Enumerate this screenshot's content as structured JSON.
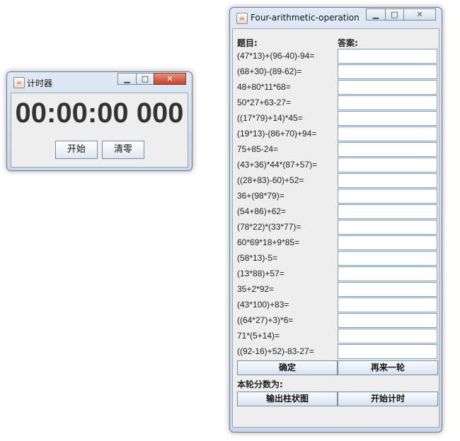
{
  "stopwatch": {
    "title": "计时器",
    "display": "00:00:00 000",
    "start_label": "开始",
    "clear_label": "清零",
    "minimize_glyph": "▁",
    "maximize_glyph": "□",
    "close_glyph": "✕"
  },
  "quiz": {
    "title": "Four-arithmetic-operation",
    "minimize_glyph": "▁",
    "maximize_glyph": "□",
    "close_glyph": "✕",
    "question_header": "题目:",
    "answer_header": "答案:",
    "questions": [
      "(47*13)+(96-40)-94=",
      "(68+30)-(89-62)=",
      "48+80*11*68=",
      "50*27+63-27=",
      "((17*79)+14)*45=",
      "(19*13)-(86+70)+94=",
      "75+85-24=",
      "(43+36)*44*(87+57)=",
      "((28+83)-60)+52=",
      "36+(98*79)=",
      "(54+86)+62=",
      "(78*22)*(33*77)=",
      "60*69*18+9*85=",
      "(58*13)-5=",
      "(13*88)+57=",
      "35+2*92=",
      "(43*100)+83=",
      "((64*27)+3)*6=",
      "71*(5+14)=",
      "((92-16)+52)-83-27="
    ],
    "answers": [
      "",
      "",
      "",
      "",
      "",
      "",
      "",
      "",
      "",
      "",
      "",
      "",
      "",
      "",
      "",
      "",
      "",
      "",
      "",
      ""
    ],
    "confirm_label": "确定",
    "again_label": "再来一轮",
    "score_label": "本轮分数为:",
    "chart_label": "输出柱状图",
    "timer_label": "开始计时"
  }
}
